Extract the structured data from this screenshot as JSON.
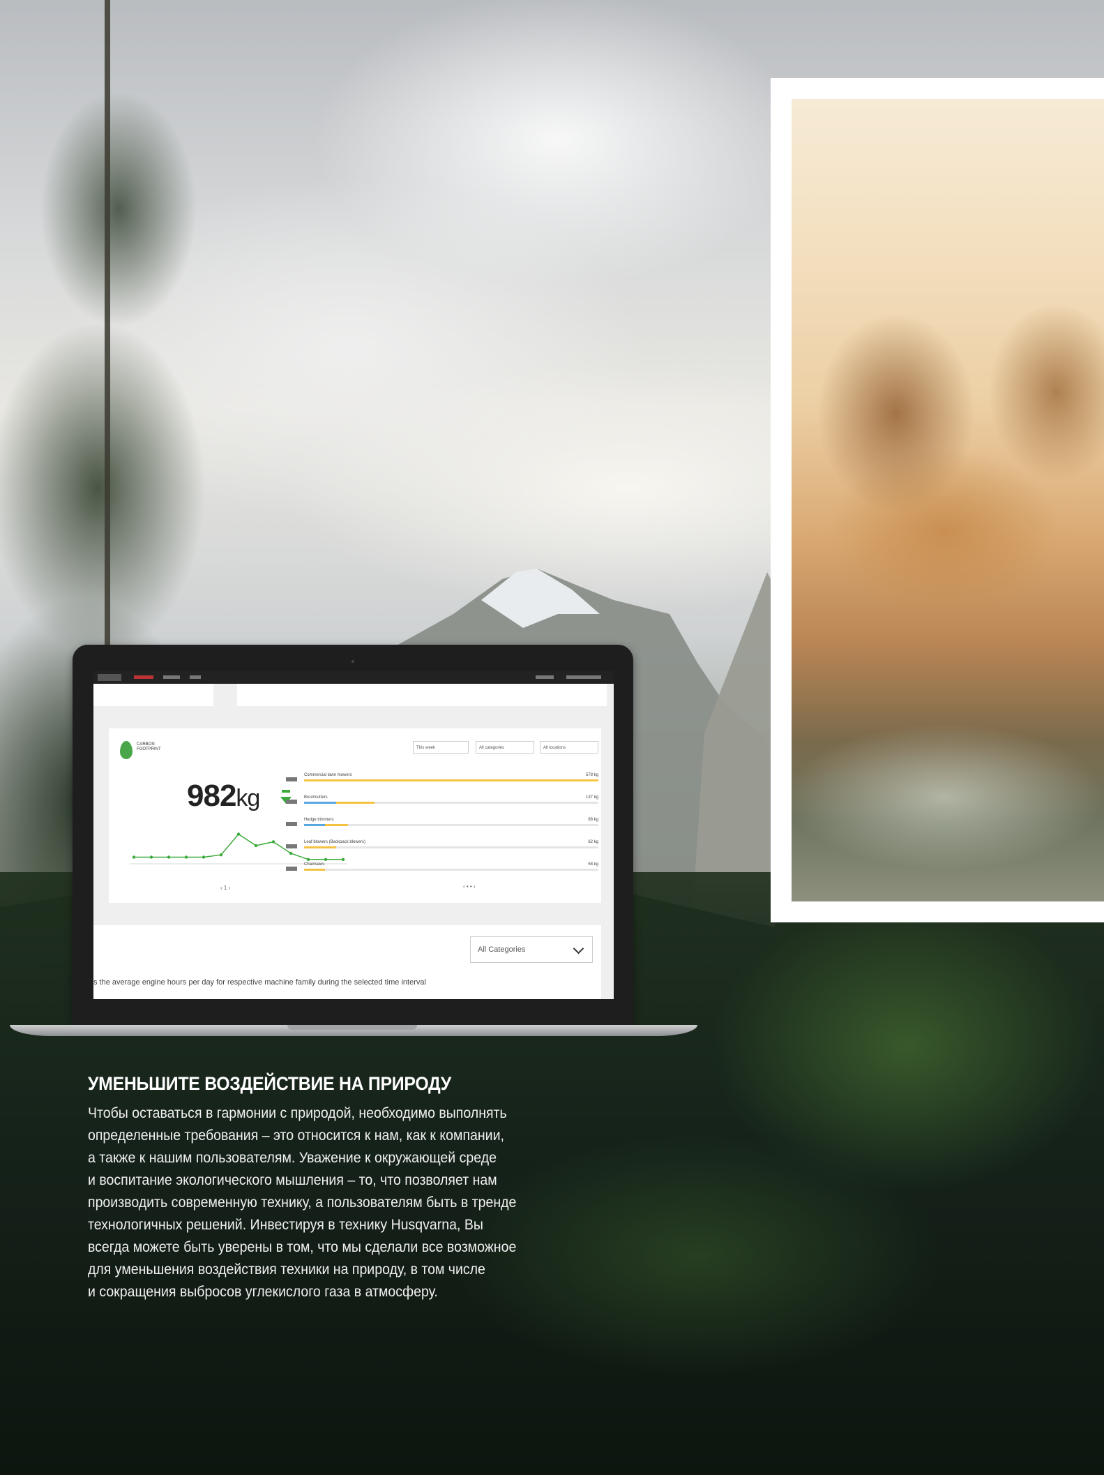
{
  "hero": {
    "headline": "УМЕНЬШИТЕ ВОЗДЕЙСТВИЕ НА ПРИРОДУ",
    "paragraph_lines": [
      "Чтобы оставаться в гармонии с природой, необходимо выполнять",
      "определенные требования – это относится к нам, как к компании,",
      "а также к нашим пользователям. Уважение к окружающей среде",
      "и воспитание экологического мышления – то, что позволяет нам",
      "производить современную технику, а пользователям быть в тренде",
      "технологичных решений. Инвестируя в технику Husqvarna, Вы",
      "всегда можете быть уверены в том, что мы сделали все возможное",
      "для уменьшения воздействия техники на природу, в том числе",
      "и сокращения выбросов углекислого газа в атмосферу."
    ]
  },
  "laptop_screen": {
    "carbon_footprint_label": "CARBON FOOTPRINT",
    "total_value": "982",
    "total_unit": "kg",
    "filters": [
      "This week",
      "All categories",
      "All locations"
    ],
    "pager_left": "‹ 1 ›",
    "pager_right": "‹ • • ›",
    "category_select": "All Categories",
    "caption": "s the average engine hours per day for respective machine family during the selected time interval",
    "breakdown": [
      {
        "name": "Commercial lawn mowers",
        "value": "578 kg",
        "fill": 1.0,
        "blue": 0
      },
      {
        "name": "Brushcutters",
        "value": "137 kg",
        "fill": 0.24,
        "blue": 0.11
      },
      {
        "name": "Hedge trimmers",
        "value": "88 kg",
        "fill": 0.15,
        "blue": 0.07
      },
      {
        "name": "Leaf blowers (Backpack blowers)",
        "value": "62 kg",
        "fill": 0.11,
        "blue": 0
      },
      {
        "name": "Chainsaws",
        "value": "58 kg",
        "fill": 0.07,
        "blue": 0
      }
    ],
    "trend_values": [
      5,
      5,
      5,
      5,
      5,
      8,
      35,
      20,
      25,
      10,
      2,
      2,
      2
    ]
  },
  "colors": {
    "accent_green": "#3caa3c",
    "bar_yellow": "#f4c342",
    "bar_blue": "#5aa7e0"
  }
}
